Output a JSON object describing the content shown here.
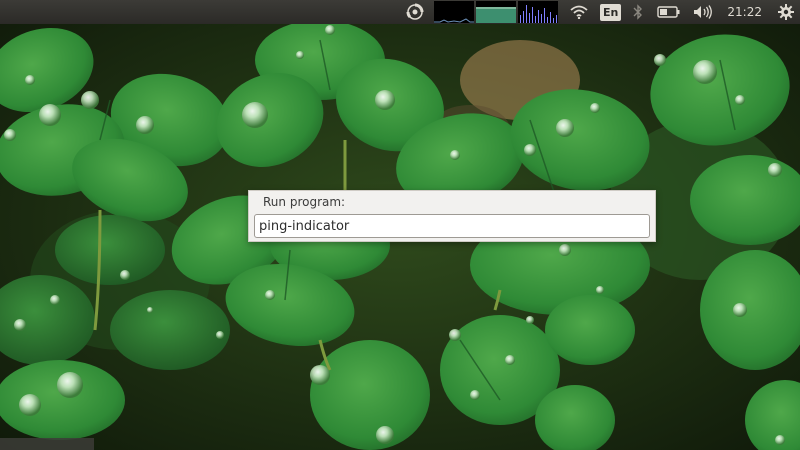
{
  "panel": {
    "indicators": [
      "ubuntu-swirl-icon",
      "cpu-monitor",
      "memory-monitor",
      "network-monitor",
      "wifi-icon",
      "keyboard-layout",
      "bluetooth-icon",
      "battery-icon",
      "volume-icon",
      "clock",
      "settings-gear-icon"
    ],
    "keyboard_layout": "En",
    "clock": "21:22",
    "colors": {
      "panel_bg": "#3c3b37",
      "cpu_graph": "#6a8fb8",
      "mem_graph": "#3d8f6f",
      "net_graph": "#8080ff"
    }
  },
  "run_dialog": {
    "label": "Run program:",
    "input_value": "ping-indicator"
  },
  "wallpaper": {
    "description_icon": "clover-wallpaper"
  }
}
